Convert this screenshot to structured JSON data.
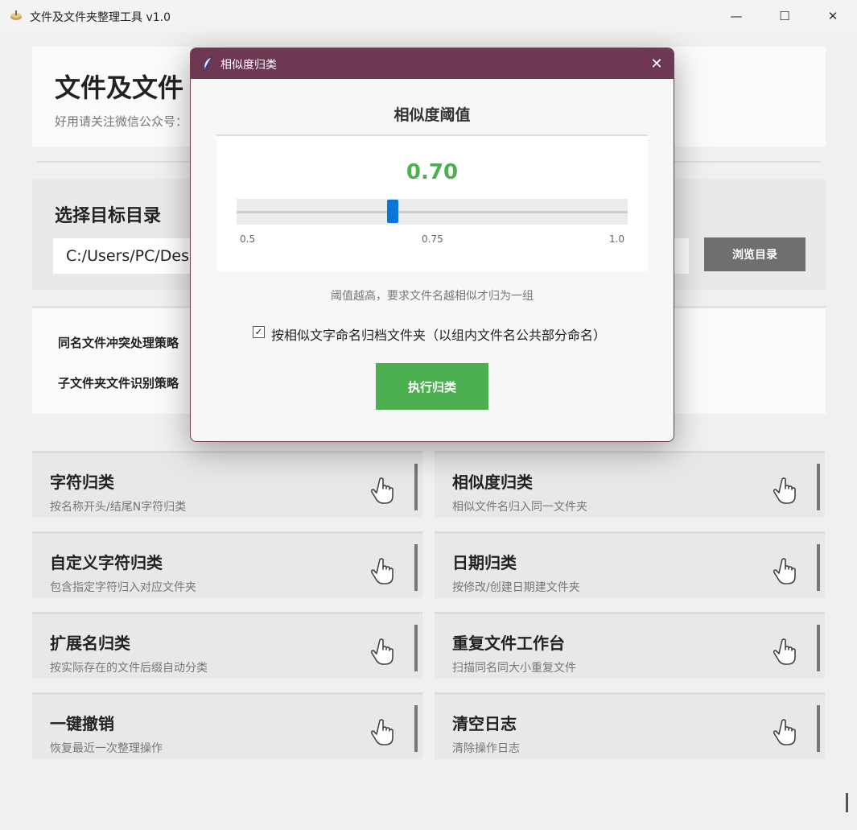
{
  "window": {
    "title": "文件及文件夹整理工具 v1.0",
    "minimize": "—",
    "maximize": "☐",
    "close": "✕"
  },
  "header": {
    "title": "文件及文件",
    "subtitle": "好用请关注微信公众号："
  },
  "directory": {
    "title": "选择目标目录",
    "path_value": "C:/Users/PC/Desk",
    "browse_label": "浏览目录"
  },
  "options": {
    "conflict_label": "同名文件冲突处理策略",
    "subfolder_label": "子文件夹文件识别策略"
  },
  "tools": [
    {
      "title": "字符归类",
      "desc": "按名称开头/结尾N字符归类"
    },
    {
      "title": "相似度归类",
      "desc": "相似文件名归入同一文件夹"
    },
    {
      "title": "自定义字符归类",
      "desc": "包含指定字符归入对应文件夹"
    },
    {
      "title": "日期归类",
      "desc": "按修改/创建日期建文件夹"
    },
    {
      "title": "扩展名归类",
      "desc": "按实际存在的文件后缀自动分类"
    },
    {
      "title": "重复文件工作台",
      "desc": "扫描同名同大小重复文件"
    },
    {
      "title": "一键撤销",
      "desc": "恢复最近一次整理操作"
    },
    {
      "title": "清空日志",
      "desc": "清除操作日志"
    }
  ],
  "dialog": {
    "title": "相似度归类",
    "close": "✕",
    "heading": "相似度阈值",
    "value_text": "0.70",
    "slider": {
      "min": 0.5,
      "max": 1.0,
      "value": 0.7
    },
    "ticks": [
      "0.5",
      "0.75",
      "1.0"
    ],
    "hint": "阈值越高，要求文件名越相似才归为一组",
    "checkbox_checked": true,
    "checkbox_mark": "✓",
    "checkbox_label": "按相似文字命名归档文件夹（以组内文件名公共部分命名）",
    "run_label": "执行归类"
  },
  "colors": {
    "dialog_titlebar": "#6e3752",
    "accent_green": "#4caf50",
    "slider_thumb": "#0a74d8",
    "browse_button": "#6f6f6f"
  }
}
